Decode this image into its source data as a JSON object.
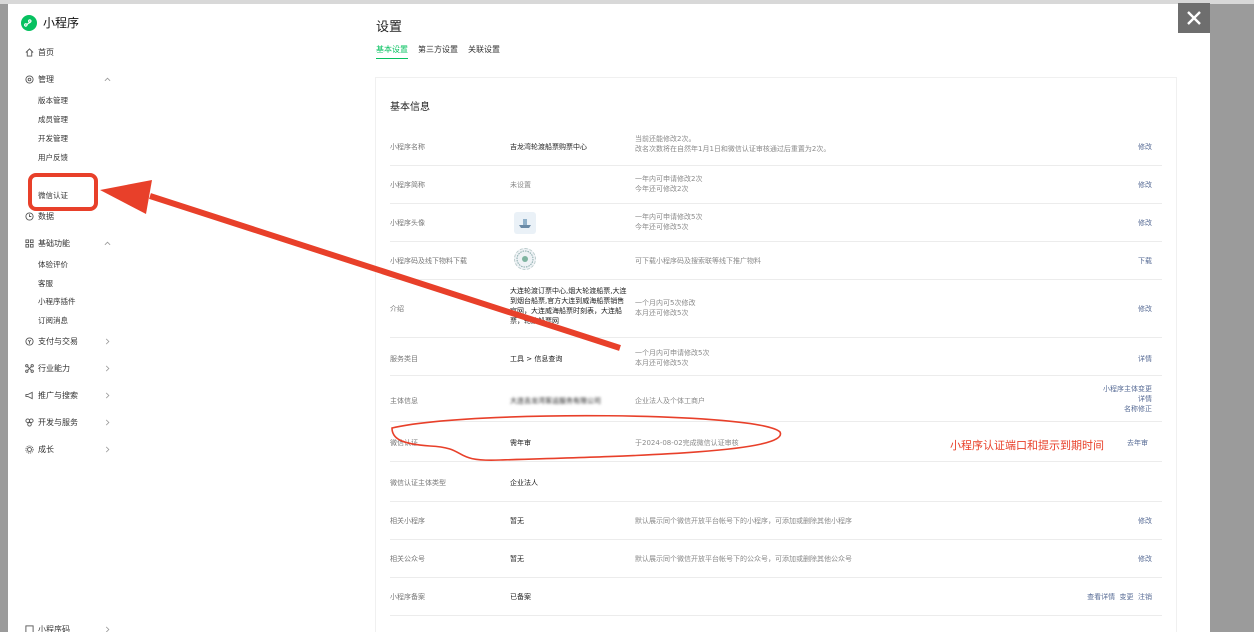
{
  "app": {
    "name": "小程序"
  },
  "sidebar": {
    "home": "首页",
    "manage": "管理",
    "manage_items": [
      "版本管理",
      "成员管理",
      "开发管理",
      "用户反馈",
      "",
      "微信认证"
    ],
    "data": "数据",
    "basic": "基础功能",
    "basic_items": [
      "体验评价",
      "客服",
      "小程序插件",
      "订阅消息"
    ],
    "pay": "支付与交易",
    "industry": "行业能力",
    "promote": "推广与搜索",
    "dev": "开发与服务",
    "growth": "成长",
    "bottom": "小程序码"
  },
  "page": {
    "title": "设置",
    "tabs": [
      "基本设置",
      "第三方设置",
      "关联设置"
    ],
    "section_title": "基本信息"
  },
  "rows": [
    {
      "label": "小程序名称",
      "value": "吉龙湾轮渡船票购票中心",
      "hint": [
        "当前还能修改2次。",
        "改名次数将在自然年1月1日和微信认证审核通过后重置为2次。"
      ],
      "action": [
        "修改"
      ]
    },
    {
      "label": "小程序简称",
      "value": "未设置",
      "hint": [
        "一年内可申请修改2次",
        "今年还可修改2次"
      ],
      "action": [
        "修改"
      ]
    },
    {
      "label": "小程序头像",
      "value": "",
      "hint": [
        "一年内可申请修改5次",
        "今年还可修改5次"
      ],
      "action": [
        "修改"
      ]
    },
    {
      "label": "小程序码及线下物料下载",
      "value": "",
      "hint": [
        "可下载小程序码及搜索联等线下推广物料"
      ],
      "action": [
        "下载"
      ]
    },
    {
      "label": "介绍",
      "value": "大连轮渡订票中心,烟大轮渡船票,大连到烟台船票,官方大连到威海船票销售官网，大连威海船票时刻表，大连船票，轮渡船票网",
      "hint": [
        "一个月内可5次修改",
        "本月还可修改5次"
      ],
      "action": [
        "修改"
      ]
    },
    {
      "label": "服务类目",
      "value": "工具 > 信息查询",
      "hint": [
        "一个月内可申请修改5次",
        "本月还可修改5次"
      ],
      "action": [
        "详情"
      ]
    },
    {
      "label": "主体信息",
      "value": "大连吉龙湾客运服务有限公司",
      "hint": [
        "企业法人及个体工商户"
      ],
      "action": [
        "小程序主体变更",
        "详情",
        "名称修正"
      ]
    },
    {
      "label": "微信认证",
      "value": "需年审",
      "hint": [
        "于2024-08-02完成微信认证审核"
      ],
      "action": [
        "去年审"
      ]
    },
    {
      "label": "微信认证主体类型",
      "value": "企业法人",
      "hint": [],
      "action": []
    },
    {
      "label": "相关小程序",
      "value": "暂无",
      "hint": [
        "默认展示同个微信开放平台帐号下的小程序，可添加或删除其他小程序"
      ],
      "action": [
        "修改"
      ]
    },
    {
      "label": "相关公众号",
      "value": "暂无",
      "hint": [
        "默认展示同个微信开放平台帐号下的公众号，可添加或删除其他公众号"
      ],
      "action": [
        "修改"
      ]
    },
    {
      "label": "小程序备案",
      "value": "已备案",
      "hint": [],
      "action": [
        "查看详情",
        "变更",
        "注销"
      ]
    }
  ],
  "annotation": {
    "text": "小程序认证端口和提示到期时间"
  },
  "colors": {
    "accent": "#07c160",
    "link": "#576b95",
    "annotation": "#e8402a"
  }
}
